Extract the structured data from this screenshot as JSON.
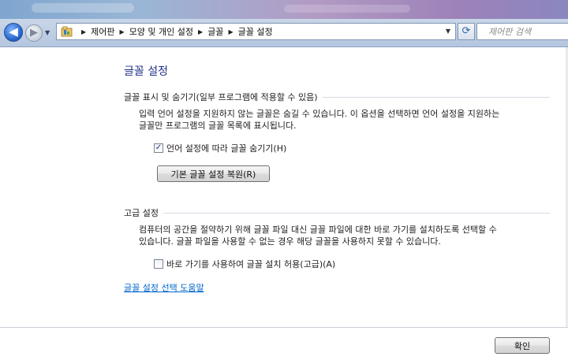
{
  "navbar": {
    "back_glyph": "◀",
    "forward_glyph": "▶",
    "history_glyph": "▼",
    "breadcrumb": [
      "제어판",
      "모양 및 개인 설정",
      "글꼴",
      "글꼴 설정"
    ],
    "breadcrumb_separator": "▶",
    "address_dropdown_glyph": "▼",
    "refresh_glyph": "⟳",
    "search_placeholder": "제어판 검색"
  },
  "page": {
    "title": "글꼴 설정"
  },
  "show_hide_section": {
    "heading": "글꼴 표시 및 숨기기(일부 프로그램에 적용할 수 있음)",
    "description_line1": "입력 언어 설정을 지원하지 않는 글꼴은 숨길 수 있습니다. 이 옵션을 선택하면 언어 설정을 지원하는",
    "description_line2": "글꼴만 프로그램의 글꼴 목록에 표시됩니다.",
    "hide_checkbox_label": "언어 설정에 따라 글꼴 숨기기(H)",
    "hide_checkbox_checked": true,
    "restore_button_label": "기본 글꼴 설정 복원(R)"
  },
  "advanced_section": {
    "heading": "고급 설정",
    "description_line1": "컴퓨터의 공간을 절약하기 위해 글꼴 파일 대신 글꼴 파일에 대한 바로 가기를 설치하도록 선택할 수",
    "description_line2": "있습니다. 글꼴 파일을 사용할 수 없는 경우 해당 글꼴을 사용하지 못할 수 있습니다.",
    "shortcut_checkbox_label": "바로 가기를 사용하여 글꼴 설치 허용(고급)(A)",
    "shortcut_checkbox_checked": false
  },
  "help_link": "글꼴 설정 선택 도움말",
  "footer": {
    "ok_button_label": "확인"
  },
  "colors": {
    "title_blue": "#1e3287",
    "link_blue": "#0066cc"
  }
}
